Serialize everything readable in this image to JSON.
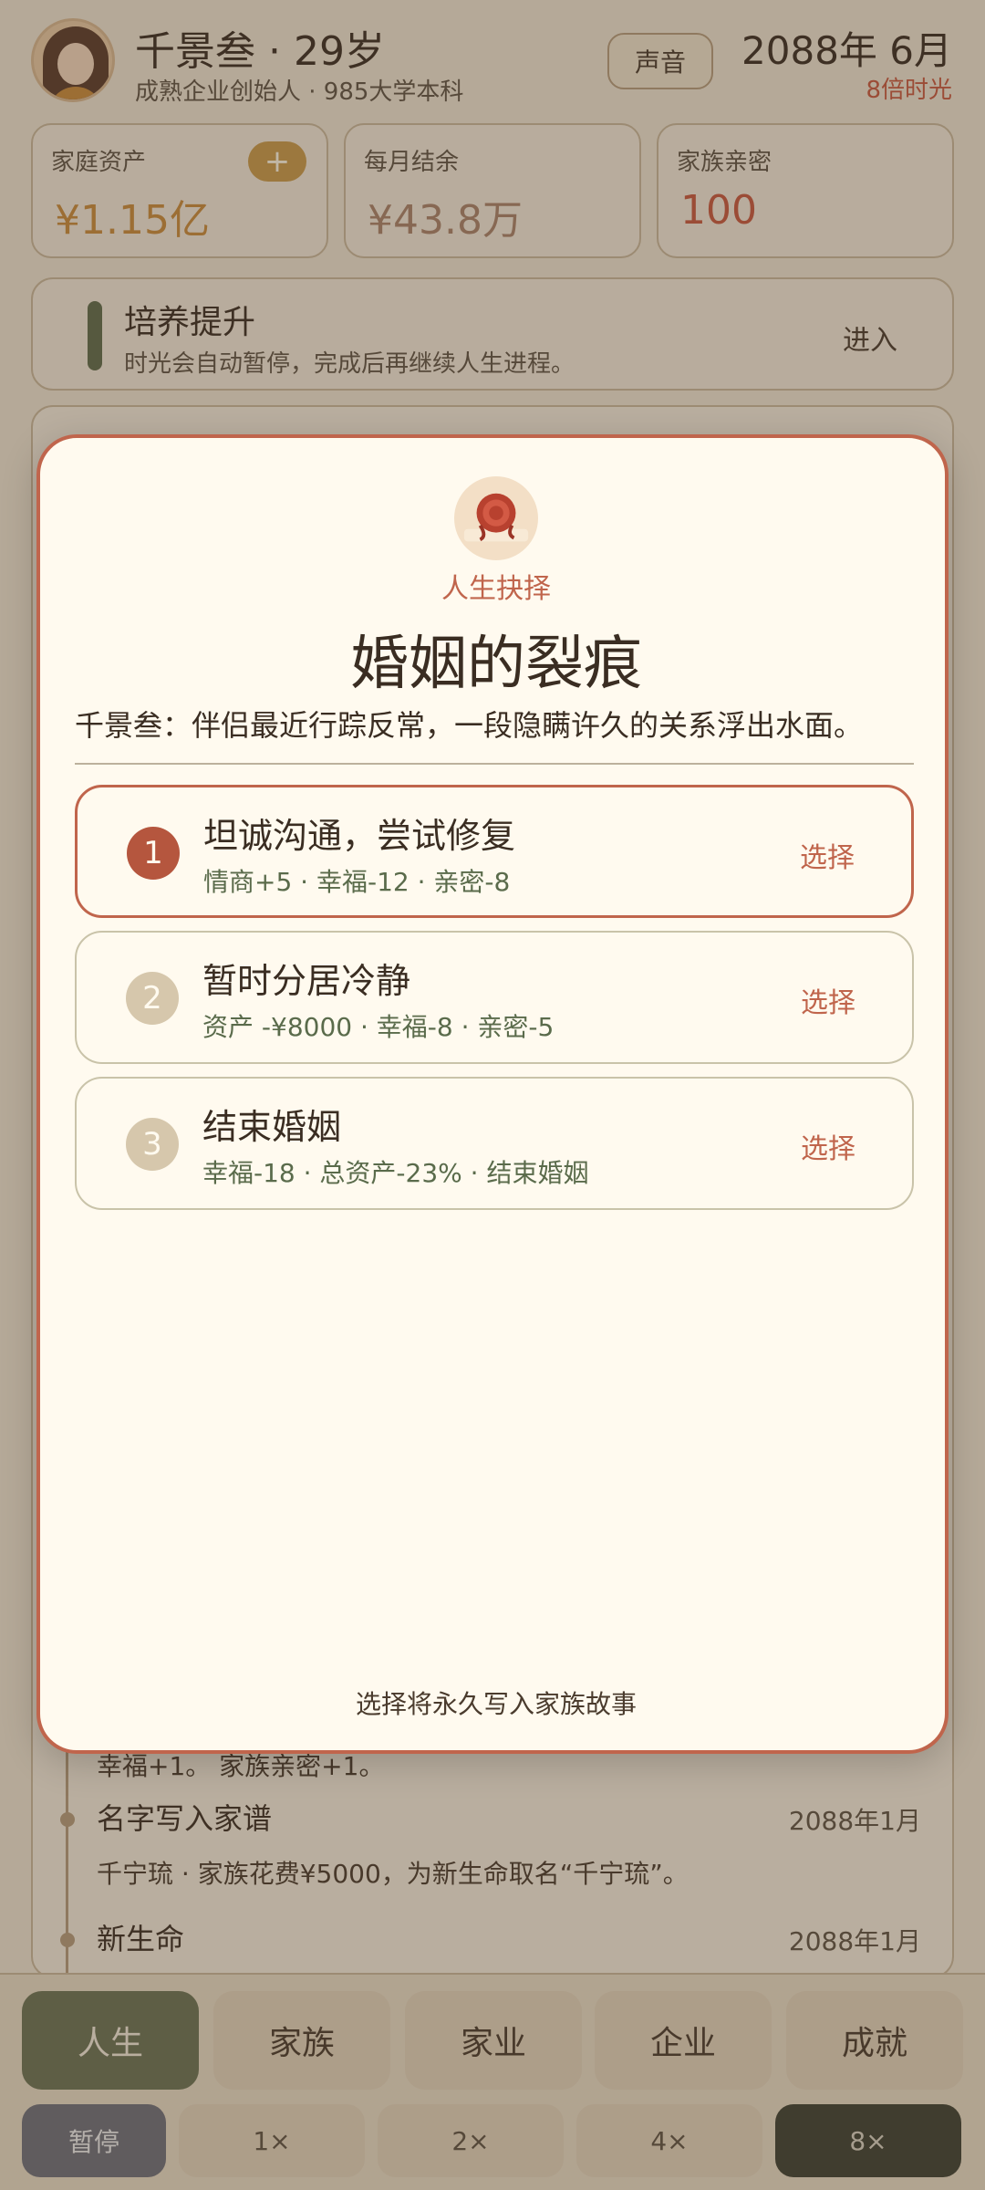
{
  "header": {
    "name_age": "千景叁 · 29岁",
    "subtitle": "成熟企业创始人 · 985大学本科",
    "sound_label": "声音",
    "date": "2088年 6月",
    "speed_note": "8倍时光"
  },
  "stats": [
    {
      "label": "家庭资产",
      "value": "¥1.15亿",
      "action": "+"
    },
    {
      "label": "每月结余",
      "value": "¥43.8万"
    },
    {
      "label": "家族亲密",
      "value": "100"
    }
  ],
  "train": {
    "title": "培养提升",
    "desc": "时光会自动暂停，完成后再继续人生进程。",
    "enter": "进入"
  },
  "timeline": [
    {
      "desc": "幸福+1。 家族亲密+1。"
    },
    {
      "title": "名字写入家谱",
      "date": "2088年1月",
      "desc": "千宁琉 · 家族花费¥5000，为新生命取名“千宁琉”。"
    },
    {
      "title": "新生命",
      "date": "2088年1月"
    }
  ],
  "modal": {
    "kicker": "人生抉择",
    "title": "婚姻的裂痕",
    "desc": "千景叁：伴侣最近行踪反常，一段隐瞒许久的关系浮出水面。",
    "options": [
      {
        "num": "1",
        "title": "坦诚沟通，尝试修复",
        "effects": "情商+5 · 幸福-12 · 亲密-8",
        "select": "选择"
      },
      {
        "num": "2",
        "title": "暂时分居冷静",
        "effects": "资产 -¥8000 · 幸福-8 · 亲密-5",
        "select": "选择"
      },
      {
        "num": "3",
        "title": "结束婚姻",
        "effects": "幸福-18 · 总资产-23% · 结束婚姻",
        "select": "选择"
      }
    ],
    "footer": "选择将永久写入家族故事"
  },
  "nav": {
    "tabs": [
      "人生",
      "家族",
      "家业",
      "企业",
      "成就"
    ],
    "speeds": [
      "暂停",
      "1×",
      "2×",
      "4×",
      "8×"
    ]
  }
}
